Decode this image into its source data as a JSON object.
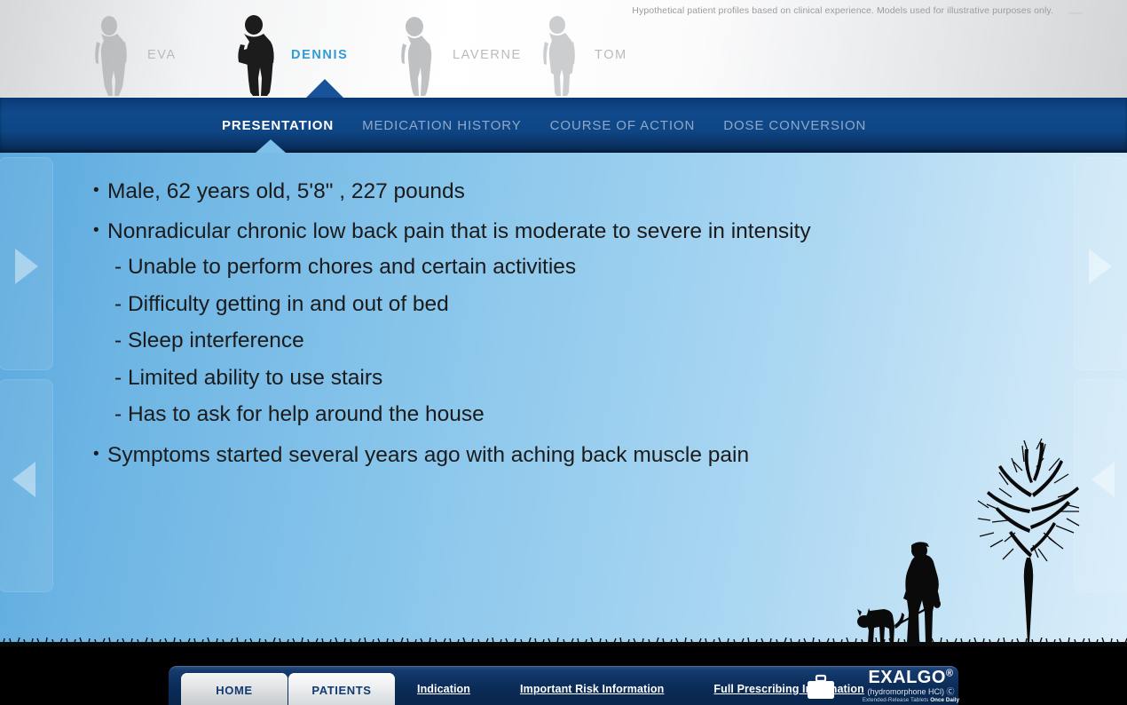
{
  "window": {
    "disclaimer": "Hypothetical patient profiles based on clinical experience. Models used for illustrative purposes only.",
    "minimize_label": "—",
    "close_label": "✕"
  },
  "patients": {
    "selected": "DENNIS",
    "items": [
      {
        "label": "EVA",
        "icon": "patient-silhouette-icon",
        "active": false
      },
      {
        "label": "DENNIS",
        "icon": "patient-silhouette-icon",
        "active": true
      },
      {
        "label": "LAVERNE",
        "icon": "patient-silhouette-icon",
        "active": false
      },
      {
        "label": "TOM",
        "icon": "patient-silhouette-icon",
        "active": false
      }
    ]
  },
  "nav": {
    "tabs": [
      {
        "label": "PRESENTATION",
        "active": true
      },
      {
        "label": "MEDICATION HISTORY",
        "active": false
      },
      {
        "label": "COURSE OF ACTION",
        "active": false
      },
      {
        "label": "DOSE CONVERSION",
        "active": false
      }
    ]
  },
  "content": {
    "bullets": [
      "Male, 62 years old, 5'8\" , 227 pounds",
      "Nonradicular chronic low back pain that is moderate to severe in intensity",
      "Symptoms started several years ago with aching back muscle pain"
    ],
    "sub_bullets": [
      "- Unable to perform chores and certain activities",
      "- Difficulty getting in and out of bed",
      "- Sleep interference",
      "- Limited ability to use stairs",
      "- Has to ask for help around the house"
    ],
    "bullet_marker": "•"
  },
  "side_nav": {
    "left_top_icon": "arrow-right-icon",
    "left_bottom_icon": "arrow-left-icon",
    "right_top_icon": "arrow-right-icon",
    "right_bottom_icon": "arrow-left-icon"
  },
  "footer": {
    "tabs": [
      {
        "label": "HOME",
        "active": false
      },
      {
        "label": "PATIENTS",
        "active": true
      }
    ],
    "links": [
      "Indication",
      "Important Risk Information",
      "Full Prescribing Information"
    ],
    "briefcase_icon": "briefcase-icon",
    "logo": {
      "name": "EXALGO",
      "registered": "®",
      "generic": "(hydromorphone HCl) Ⓒ",
      "tagline_1": "Extended-Release Tablets",
      "tagline_2": "Once Daily"
    }
  },
  "colors": {
    "brand_navy": "#0b3570",
    "accent_blue": "#2f9bd7",
    "pointer_blue": "#7ec0ea",
    "content_bg_start": "#5aa9de",
    "content_bg_end": "#d9edfa"
  }
}
